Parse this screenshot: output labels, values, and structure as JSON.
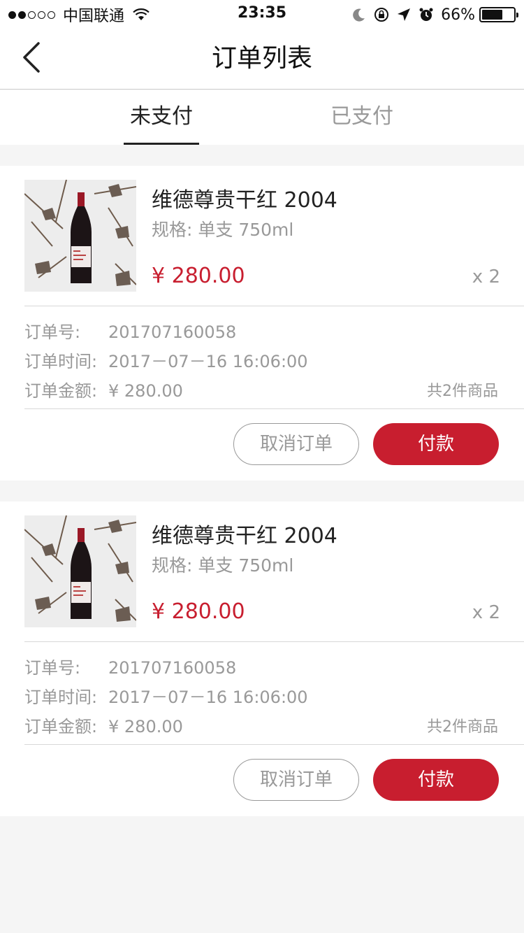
{
  "status_bar": {
    "carrier": "中国联通",
    "time": "23:35",
    "battery": "66%",
    "battery_level": 0.66,
    "signal_bars": 2
  },
  "nav": {
    "title": "订单列表",
    "back_icon": "chevron-left-icon"
  },
  "tabs": [
    {
      "label": "未支付",
      "active": true
    },
    {
      "label": "已支付",
      "active": false
    }
  ],
  "colors": {
    "accent": "#c81e2f",
    "muted_text": "#999999",
    "background": "#f5f5f5"
  },
  "orders": [
    {
      "product_name": "维德尊贵干红 2004",
      "spec": "规格:  单支 750ml",
      "price": "¥ 280.00",
      "quantity": "x 2",
      "order_no_label": "订单号:",
      "order_no": "201707160058",
      "order_time_label": "订单时间:",
      "order_time": "2017－07－16  16:06:00",
      "amount_label": "订单金额:",
      "amount": "¥ 280.00",
      "item_count": "共2件商品",
      "cancel_label": "取消订单",
      "pay_label": "付款"
    },
    {
      "product_name": "维德尊贵干红 2004",
      "spec": "规格:  单支 750ml",
      "price": "¥ 280.00",
      "quantity": "x 2",
      "order_no_label": "订单号:",
      "order_no": "201707160058",
      "order_time_label": "订单时间:",
      "order_time": "2017－07－16  16:06:00",
      "amount_label": "订单金额:",
      "amount": "¥ 280.00",
      "item_count": "共2件商品",
      "cancel_label": "取消订单",
      "pay_label": "付款"
    }
  ]
}
